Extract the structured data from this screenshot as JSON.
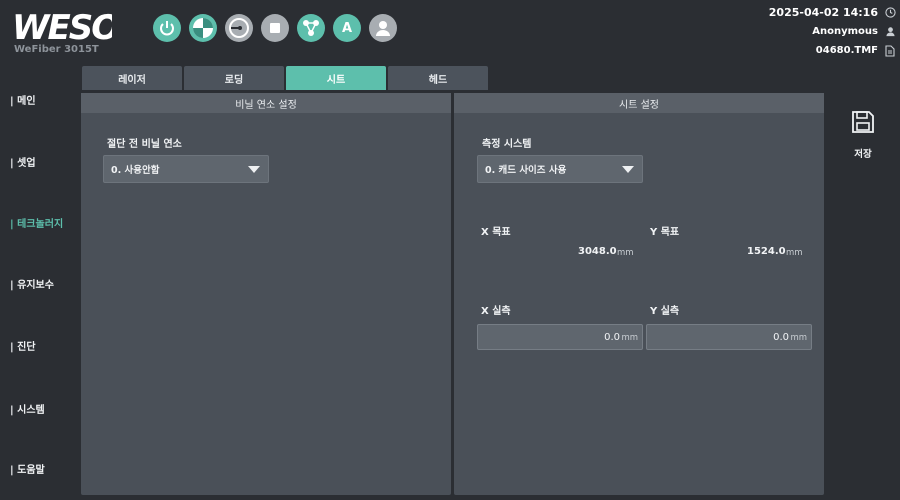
{
  "app": {
    "brand": "WESO",
    "model": "WeFiber 3015T"
  },
  "status": {
    "datetime": "2025-04-02 14:16",
    "user": "Anonymous",
    "file": "04680.TMF",
    "datetime_icon": "clock-icon",
    "user_icon": "user-icon",
    "file_icon": "file-icon"
  },
  "toolbar": [
    {
      "name": "power-button",
      "icon": "power-icon",
      "color": "#5dbfac"
    },
    {
      "name": "pie-button",
      "icon": "pie-icon",
      "color": "#5dbfac"
    },
    {
      "name": "origin-button",
      "icon": "origin-icon",
      "color": "#a8adb2"
    },
    {
      "name": "stop-button",
      "icon": "stop-icon",
      "color": "#a8adb2"
    },
    {
      "name": "nodes-button",
      "icon": "nodes-icon",
      "color": "#5dbfac"
    },
    {
      "name": "auto-button",
      "icon": "letter-a-icon",
      "label": "A",
      "color": "#5dbfac"
    },
    {
      "name": "user-button",
      "icon": "user-icon",
      "color": "#a8adb2"
    }
  ],
  "nav": {
    "items": [
      {
        "label": "메인",
        "active": false
      },
      {
        "label": "셋업",
        "active": false
      },
      {
        "label": "테크놀러지",
        "active": true
      },
      {
        "label": "유지보수",
        "active": false
      },
      {
        "label": "진단",
        "active": false
      },
      {
        "label": "시스템",
        "active": false
      },
      {
        "label": "도움말",
        "active": false
      }
    ]
  },
  "tabs": [
    {
      "label": "레이저",
      "active": false
    },
    {
      "label": "로딩",
      "active": false
    },
    {
      "label": "시트",
      "active": true
    },
    {
      "label": "헤드",
      "active": false
    }
  ],
  "vinyl_panel": {
    "title": "비닐 연소 설정",
    "field_label": "절단 전 비닐 연소",
    "select_value": "0. 사용안함"
  },
  "sheet_panel": {
    "title": "시트 설정",
    "measure_label": "측정 시스템",
    "measure_value": "0. 캐드 사이즈 사용",
    "x_target_label": "X 목표",
    "y_target_label": "Y 목표",
    "x_target_value": "3048.0",
    "y_target_value": "1524.0",
    "x_actual_label": "X 실측",
    "y_actual_label": "Y 실측",
    "x_actual_value": "0.0",
    "y_actual_value": "0.0",
    "unit": "mm"
  },
  "save": {
    "label": "저장",
    "icon": "floppy-disk-icon"
  },
  "colors": {
    "accent": "#5dbfac",
    "background": "#2b2e33",
    "panel": "#4a5058"
  }
}
